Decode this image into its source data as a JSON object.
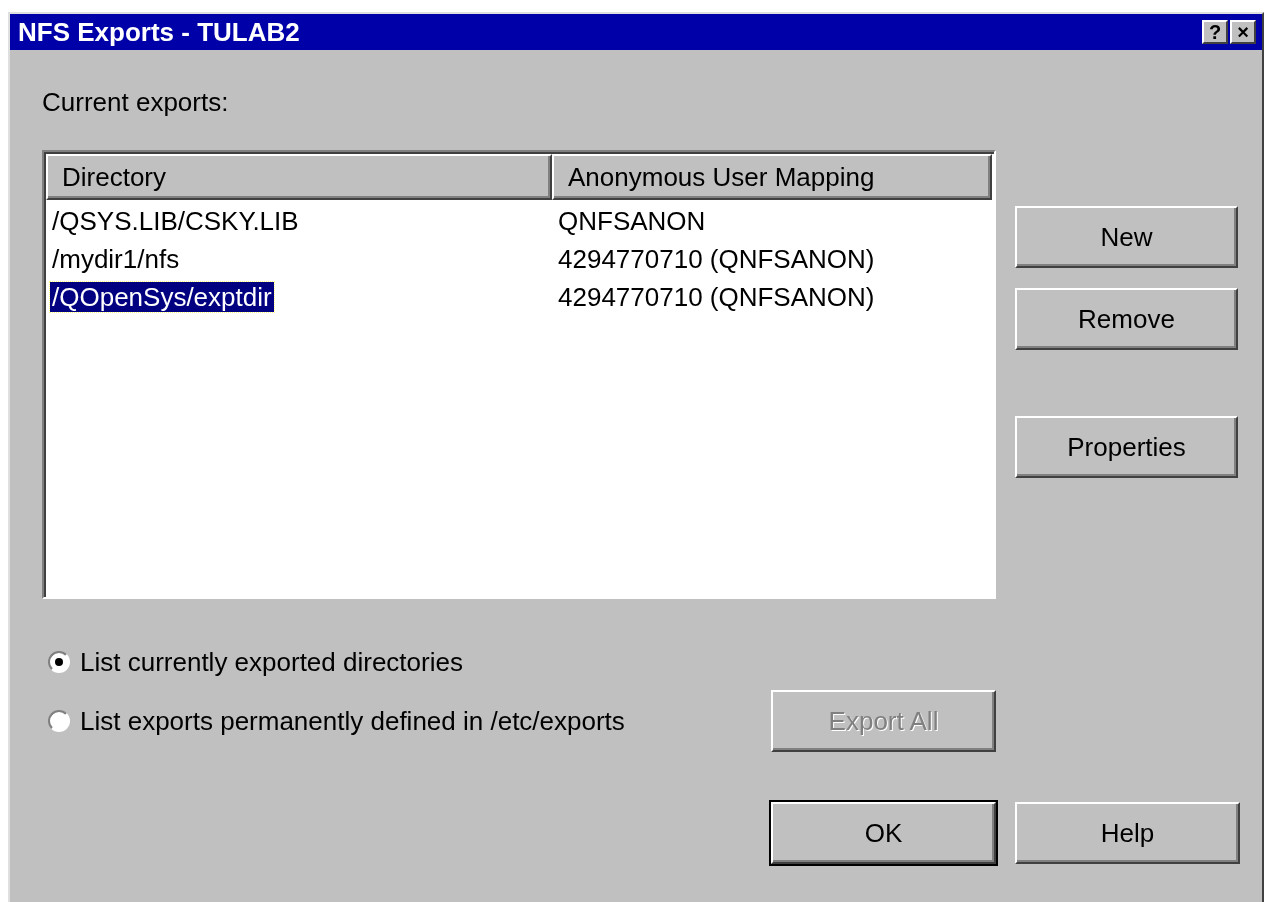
{
  "window": {
    "title": "NFS Exports - TULAB2",
    "help_button": "?",
    "close_button": "×"
  },
  "list_label": "Current exports:",
  "table": {
    "columns": [
      "Directory",
      "Anonymous User Mapping"
    ],
    "rows": [
      {
        "cells": [
          "/QSYS.LIB/CSKY.LIB",
          "QNFSANON"
        ],
        "selected": false
      },
      {
        "cells": [
          "/mydir1/nfs",
          "4294770710 (QNFSANON)"
        ],
        "selected": false
      },
      {
        "cells": [
          "/QOpenSys/exptdir",
          "4294770710 (QNFSANON)"
        ],
        "selected": true
      }
    ]
  },
  "side_buttons": [
    {
      "label": "New"
    },
    {
      "label": "Remove"
    },
    {
      "label": "Properties"
    }
  ],
  "radios": [
    {
      "label": "List currently exported directories",
      "selected": true
    },
    {
      "label": "List exports permanently defined in /etc/exports",
      "selected": false
    }
  ],
  "export_button": {
    "label": "Export All",
    "disabled": true
  },
  "footer_buttons": [
    {
      "label": "OK",
      "default": true
    },
    {
      "label": "Help",
      "default": false
    }
  ]
}
